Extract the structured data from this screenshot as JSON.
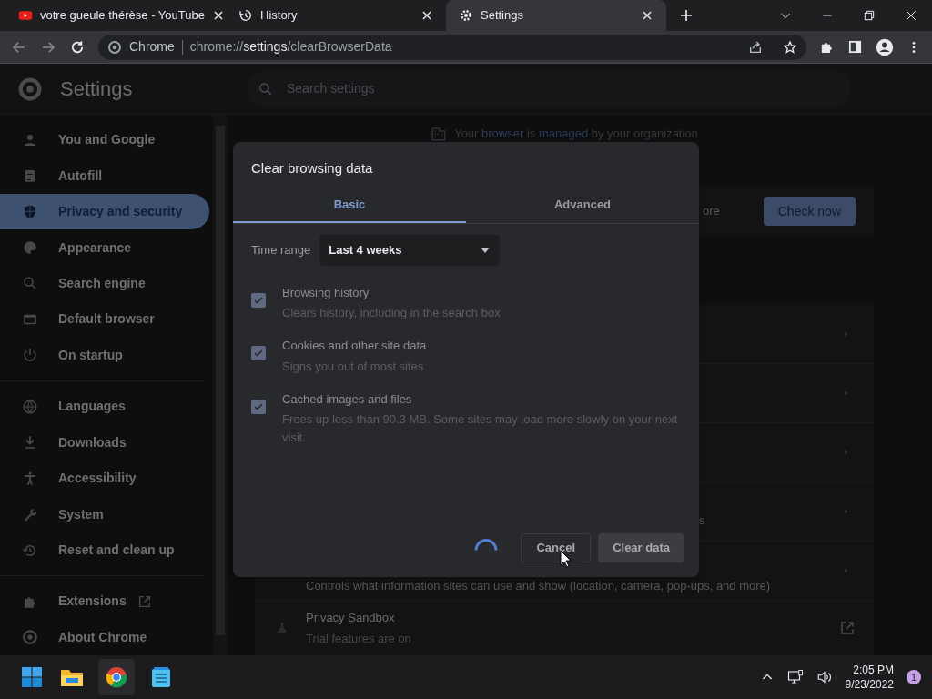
{
  "browser_tabs": [
    {
      "title": "votre gueule thérèse - YouTube",
      "selected": false
    },
    {
      "title": "History",
      "selected": false
    },
    {
      "title": "Settings",
      "selected": true
    }
  ],
  "address_bar": {
    "origin_label": "Chrome",
    "url_scheme": "chrome://",
    "url_host": "settings",
    "url_path": "/clearBrowserData"
  },
  "settings_header": {
    "title": "Settings",
    "search_placeholder": "Search settings"
  },
  "sidebar": {
    "sections": [
      [
        {
          "label": "You and Google",
          "selected": false
        },
        {
          "label": "Autofill",
          "selected": false
        },
        {
          "label": "Privacy and security",
          "selected": true
        },
        {
          "label": "Appearance",
          "selected": false
        },
        {
          "label": "Search engine",
          "selected": false
        },
        {
          "label": "Default browser",
          "selected": false
        },
        {
          "label": "On startup",
          "selected": false
        }
      ],
      [
        {
          "label": "Languages",
          "selected": false
        },
        {
          "label": "Downloads",
          "selected": false
        },
        {
          "label": "Accessibility",
          "selected": false
        },
        {
          "label": "System",
          "selected": false
        },
        {
          "label": "Reset and clean up",
          "selected": false
        }
      ],
      [
        {
          "label": "Extensions",
          "selected": false,
          "external": true
        },
        {
          "label": "About Chrome",
          "selected": false,
          "external": false
        }
      ]
    ]
  },
  "page": {
    "managed_notice": "Your **browser** is **managed** by your organization",
    "safety_check_fragment": "ore",
    "check_now": "Check now",
    "row_fragment": "s",
    "site_settings_description": "Controls what information sites can use and show (location, camera, pop-ups, and more)",
    "privacy_sandbox_title": "Privacy Sandbox",
    "privacy_sandbox_description": "Trial features are on"
  },
  "dialog": {
    "title": "Clear browsing data",
    "tabs": [
      {
        "label": "Basic",
        "selected": true
      },
      {
        "label": "Advanced",
        "selected": false
      }
    ],
    "time_range_label": "Time range",
    "time_range_value": "Last 4 weeks",
    "options": [
      {
        "title": "Browsing history",
        "description": "Clears history, including in the search box",
        "checked": true
      },
      {
        "title": "Cookies and other site data",
        "description": "Signs you out of most sites",
        "checked": true
      },
      {
        "title": "Cached images and files",
        "description": "Frees up less than 90.3 MB. Some sites may load more slowly on your next visit.",
        "checked": true
      }
    ],
    "busy": true,
    "cancel": "Cancel",
    "confirm": "Clear data"
  },
  "taskbar": {
    "time": "2:05 PM",
    "date": "9/23/2022",
    "notification_count": "1"
  }
}
